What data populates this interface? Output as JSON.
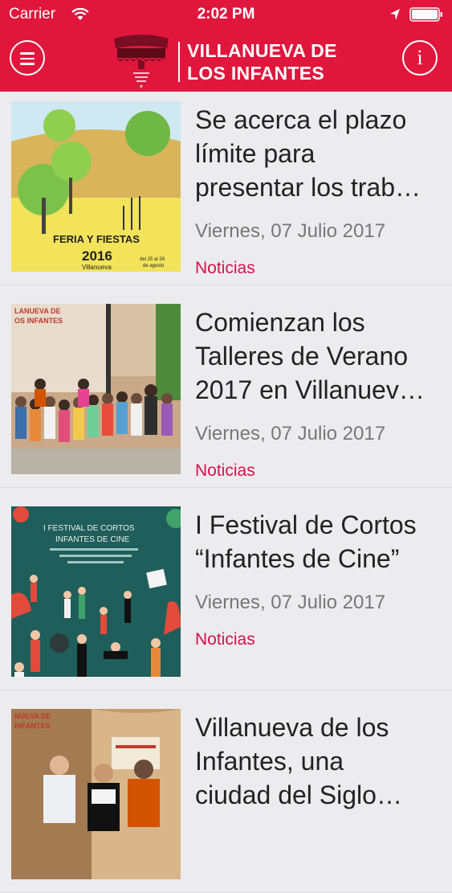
{
  "status_bar": {
    "carrier": "Carrier",
    "time": "2:02 PM"
  },
  "header": {
    "title_line1": "VILLANUEVA DE",
    "title_line2": "LOS INFANTES",
    "brand_color": "#e1163d"
  },
  "news": [
    {
      "title_lines": [
        "Se acerca el plazo",
        "límite para",
        "presentar los trab…"
      ],
      "date": "Viernes, 07 Julio 2017",
      "category": "Noticias",
      "image_text": [
        "FERIA Y FIESTAS",
        "2016",
        "Villanueva",
        "del 25 al 28",
        "de agosto"
      ]
    },
    {
      "title_lines": [
        "Comienzan los",
        "Talleres de Verano",
        "2017 en Villanuev…"
      ],
      "date": "Viernes, 07 Julio 2017",
      "category": "Noticias",
      "image_text": [
        "LANUEVA DE",
        "OS INFANTES"
      ]
    },
    {
      "title_lines": [
        "I Festival de Cortos",
        "“Infantes de Cine”"
      ],
      "date": "Viernes, 07 Julio 2017",
      "category": "Noticias",
      "image_text": [
        "I FESTIVAL DE CORTOS",
        "INFANTES DE CINE"
      ]
    },
    {
      "title_lines": [
        "Villanueva de los",
        "Infantes, una",
        "ciudad del Siglo…"
      ],
      "date": "",
      "category": "",
      "image_text": [
        "NUEVA DE",
        "INFANTES"
      ]
    }
  ]
}
